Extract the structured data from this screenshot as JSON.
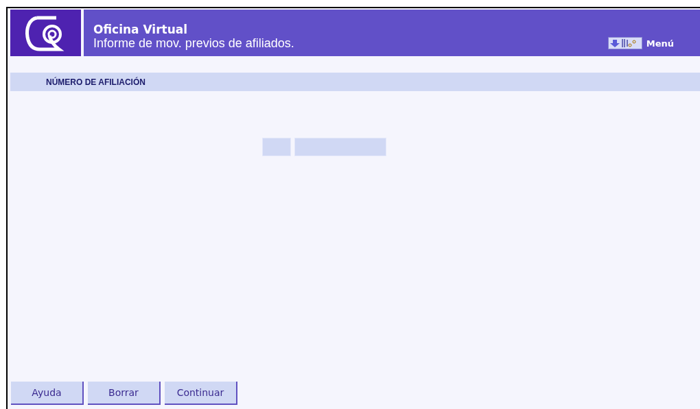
{
  "header": {
    "title": "Oficina Virtual",
    "subtitle": "Informe de mov. previos de afiliados.",
    "menu": "Menú"
  },
  "section": {
    "title": "NÚMERO DE AFILIACIÓN"
  },
  "buttons": [
    "Ayuda",
    "Borrar",
    "Continuar"
  ]
}
